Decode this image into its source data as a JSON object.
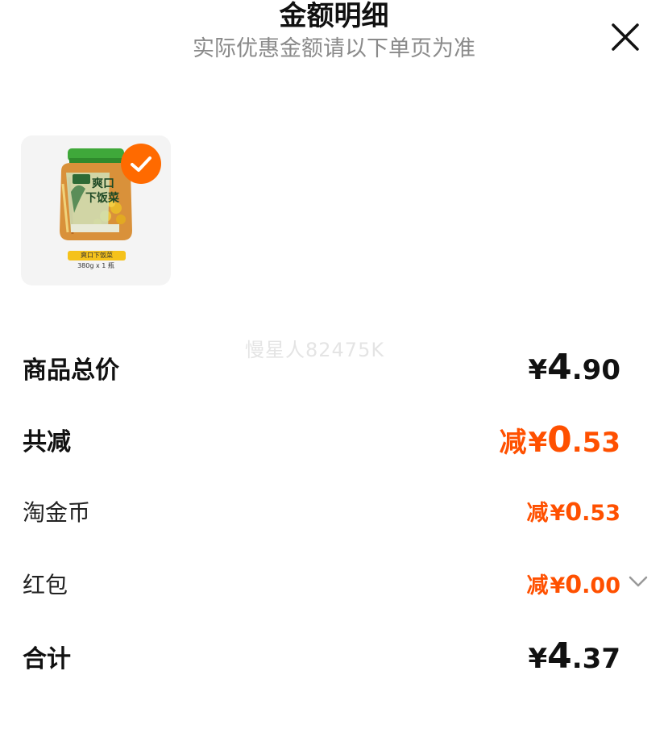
{
  "header": {
    "title": "金额明细",
    "subtitle": "实际优惠金额请以下单页为准",
    "close_icon": "close-icon"
  },
  "product": {
    "name_on_label": "爽口下饭菜",
    "qty_on_label": "380g x 1 瓶",
    "jar_text_line1": "爽口",
    "jar_text_line2": "下饭菜",
    "selected": true,
    "check_icon": "check-icon"
  },
  "watermark": "慢星人82475K",
  "rows": {
    "total_price": {
      "label": "商品总价",
      "currency": "¥",
      "int": "4",
      "dec": ".90"
    },
    "discount": {
      "label": "共减",
      "prefix": "减",
      "currency": "¥",
      "int": "0",
      "dec": ".53"
    },
    "taojinbi": {
      "label": "淘金币",
      "prefix": "减",
      "currency": "¥",
      "int": "0",
      "dec": ".53"
    },
    "hongbao": {
      "label": "红包",
      "prefix": "减",
      "currency": "¥",
      "int": "0",
      "dec": ".00",
      "chevron_icon": "chevron-down-icon"
    },
    "sum": {
      "label": "合计",
      "currency": "¥",
      "int": "4",
      "dec": ".37"
    }
  },
  "colors": {
    "accent": "#ff5000",
    "check": "#ff6a00",
    "muted": "#8a8a8a"
  }
}
